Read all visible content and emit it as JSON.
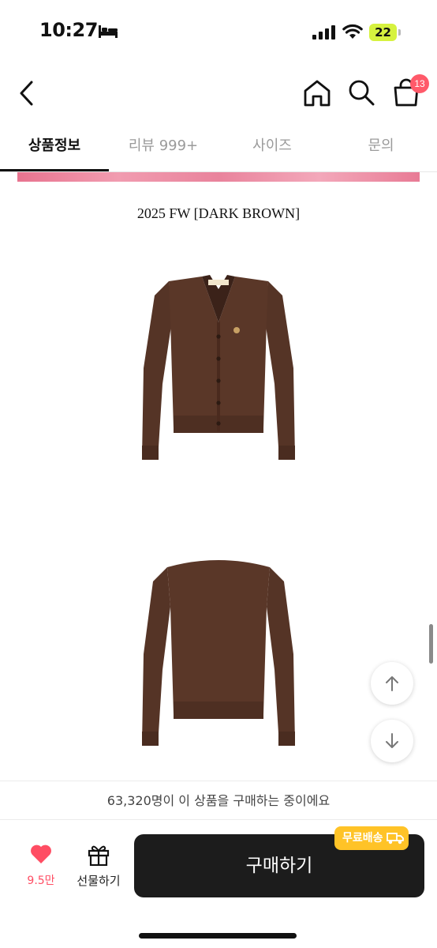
{
  "status_bar": {
    "time": "10:27",
    "battery": "22",
    "battery_color": "#d6f23f"
  },
  "header": {
    "icons": [
      "back-icon",
      "home-icon",
      "search-icon",
      "cart-icon"
    ],
    "cart_badge": "13",
    "badge_color": "#ff5a6a"
  },
  "tabs": [
    {
      "label": "상품정보",
      "active": true
    },
    {
      "label": "리뷰 999+",
      "active": false
    },
    {
      "label": "사이즈",
      "active": false
    },
    {
      "label": "문의",
      "active": false
    }
  ],
  "content": {
    "season_title": "2025 FW [DARK BROWN]",
    "product_color": "#553426",
    "images": [
      "cardigan-front",
      "cardigan-back"
    ]
  },
  "notice": {
    "text": "63,320명이 이 상품을 구매하는 중이에요"
  },
  "bottom_bar": {
    "like_count": "9.5만",
    "gift_label": "선물하기",
    "buy_label": "구매하기",
    "free_shipping_badge": "무료배송",
    "accent_color": "#ff4d63",
    "badge_color": "#ffc327"
  }
}
